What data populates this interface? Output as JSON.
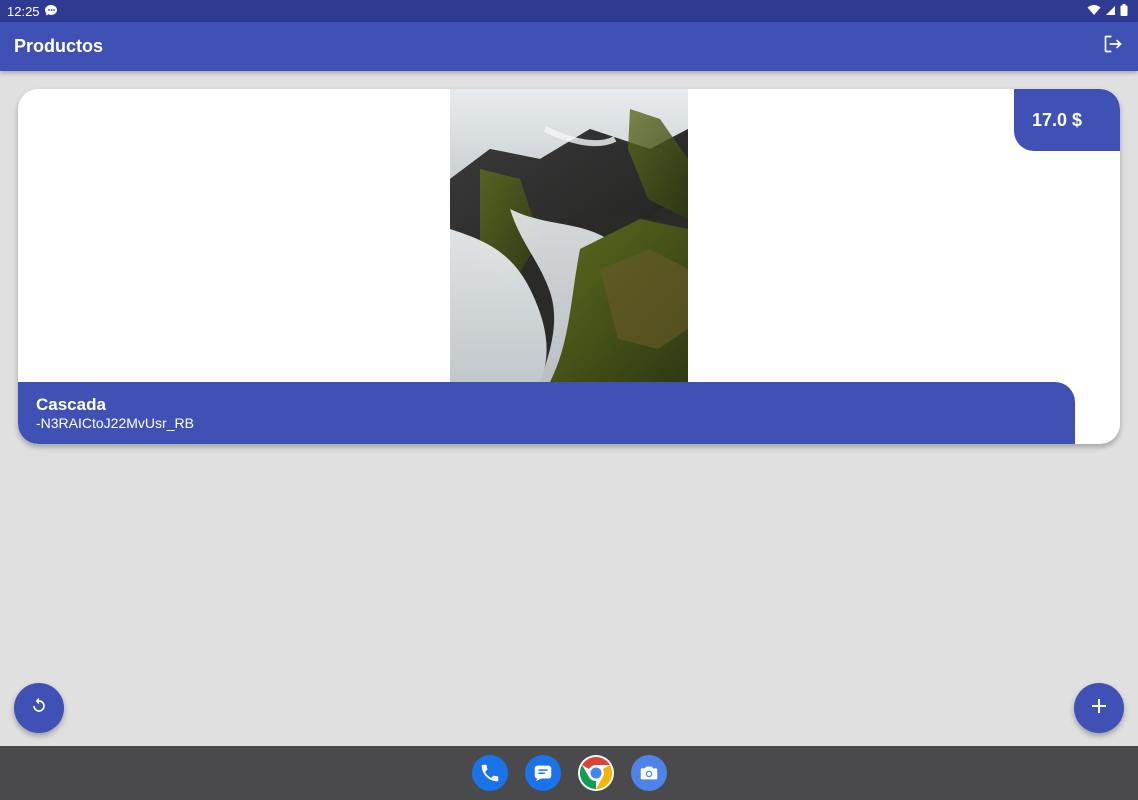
{
  "status_bar": {
    "time": "12:25",
    "icons": [
      "chat-notification-icon",
      "wifi-icon",
      "signal-icon",
      "battery-icon"
    ]
  },
  "app_bar": {
    "title": "Productos",
    "action_icon": "logout-icon"
  },
  "products": [
    {
      "name": "Cascada",
      "id": "-N3RAICtoJ22MvUsr_RB",
      "price": "17.0 $",
      "image": "waterfall-photo"
    }
  ],
  "fabs": {
    "left_icon": "refresh-icon",
    "right_icon": "add-icon"
  },
  "dock": {
    "apps": [
      "phone-app-icon",
      "messages-app-icon",
      "chrome-app-icon",
      "camera-app-icon"
    ]
  },
  "colors": {
    "primary": "#3f51b5",
    "primary_dark": "#2f3b92",
    "background": "#e0e0e0",
    "nav_bar": "#4a4a4d"
  }
}
